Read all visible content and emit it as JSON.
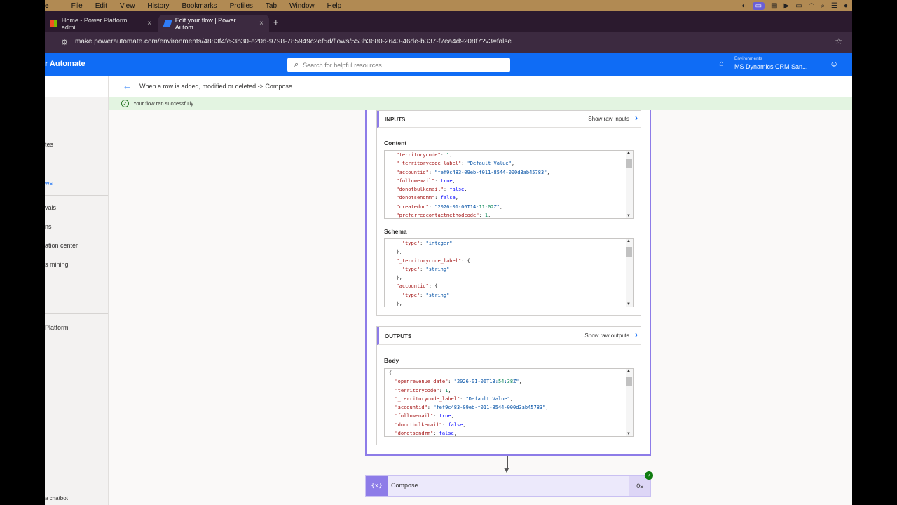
{
  "menubar": {
    "app": "e",
    "items": [
      "File",
      "Edit",
      "View",
      "History",
      "Bookmarks",
      "Profiles",
      "Tab",
      "Window",
      "Help"
    ]
  },
  "tabs": [
    {
      "label": "Home - Power Platform admi",
      "close": "×"
    },
    {
      "label": "Edit your flow | Power Autom",
      "close": "×"
    }
  ],
  "new_tab": "+",
  "url": "make.powerautomate.com/environments/4883f4fe-3b30-e20d-9798-785949c2ef5d/flows/553b3680-2640-46de-b337-f7ea4d9208f7?v3=false",
  "header": {
    "brand": "r Automate",
    "search_placeholder": "Search for helpful resources",
    "env_label": "Environments",
    "env_name": "MS Dynamics CRM San..."
  },
  "leftnav": {
    "items": [
      {
        "label": "tes",
        "active": false
      },
      {
        "label": "ws",
        "active": true
      },
      {
        "label": "vals",
        "active": false
      },
      {
        "label": "ns",
        "active": false
      },
      {
        "label": "ation center",
        "active": false
      },
      {
        "label": "s mining",
        "active": false
      },
      {
        "label": "Platform",
        "active": false
      },
      {
        "label": " a chatbot",
        "active": false
      }
    ]
  },
  "breadcrumb": "When a row is added, modified or deleted -> Compose",
  "success_message": "Your flow ran successfully.",
  "inputs": {
    "title": "INPUTS",
    "raw_label": "Show raw inputs",
    "content_label": "Content",
    "schema_label": "Schema"
  },
  "outputs": {
    "title": "OUTPUTS",
    "raw_label": "Show raw outputs",
    "body_label": "Body"
  },
  "compose": {
    "icon": "{x}",
    "name": "Compose",
    "duration": "0s"
  },
  "content_lines": [
    "  \"territorycode\": 1,",
    "  \"_territorycode_label\": \"Default Value\",",
    "  \"accountid\": \"fef9c483-09eb-f011-8544-000d3ab45783\",",
    "  \"followemail\": true,",
    "  \"donotbulkemail\": false,",
    "  \"donotsendmm\": false,",
    "  \"createdon\": \"2026-01-06T14:11:02Z\",",
    "  \"preferredcontactmethodcode\": 1,"
  ],
  "schema_lines": [
    "    \"type\": \"integer\"",
    "  },",
    "  \"_territorycode_label\": {",
    "    \"type\": \"string\"",
    "  },",
    "  \"accountid\": {",
    "    \"type\": \"string\"",
    "  },"
  ],
  "body_lines": [
    "{",
    "  \"openrevenue_date\": \"2026-01-06T13:54:38Z\",",
    "  \"territorycode\": 1,",
    "  \"_territorycode_label\": \"Default Value\",",
    "  \"accountid\": \"fef9c483-09eb-f011-8544-000d3ab45783\",",
    "  \"followemail\": true,",
    "  \"donotbulkemail\": false,",
    "  \"donotsendmm\": false,"
  ],
  "colors": {
    "accent": "#0f6cf5",
    "compose": "#8d7ce8",
    "success_bg": "#e3f4e1"
  },
  "icons": {
    "back": "arrow-left-icon",
    "search": "search-icon",
    "environment": "environment-icon",
    "success": "check-circle-icon",
    "chevron": "chevron-right-icon"
  }
}
